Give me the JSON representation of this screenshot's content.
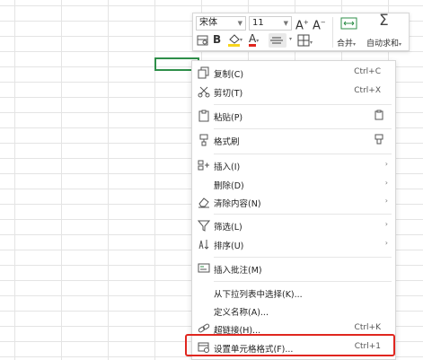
{
  "toolbar": {
    "font_name": "宋体",
    "font_size": "11",
    "increase_font": "A",
    "decrease_font": "A",
    "merge_label": "合并",
    "autosum_label": "自动求和",
    "sum_symbol": "Σ",
    "bold": "B",
    "font_color_letter": "A",
    "colors": {
      "fill": "#f7d51d",
      "font": "#e0261f"
    }
  },
  "menu": {
    "copy": {
      "label": "复制(C)",
      "shortcut": "Ctrl+C"
    },
    "cut": {
      "label": "剪切(T)",
      "shortcut": "Ctrl+X"
    },
    "paste": {
      "label": "粘贴(P)"
    },
    "format_painter": {
      "label": "格式刷"
    },
    "insert": {
      "label": "插入(I)"
    },
    "delete": {
      "label": "删除(D)"
    },
    "clear": {
      "label": "清除内容(N)"
    },
    "filter": {
      "label": "筛选(L)"
    },
    "sort": {
      "label": "排序(U)"
    },
    "insert_comment": {
      "label": "插入批注(M)"
    },
    "pick_from_list": {
      "label": "从下拉列表中选择(K)..."
    },
    "define_name": {
      "label": "定义名称(A)..."
    },
    "hyperlink": {
      "label": "超链接(H)...",
      "shortcut": "Ctrl+K"
    },
    "format_cells": {
      "label": "设置单元格格式(F)...",
      "shortcut": "Ctrl+1"
    }
  },
  "highlight_color": "#e0261f",
  "selection_color": "#2f8f4a"
}
